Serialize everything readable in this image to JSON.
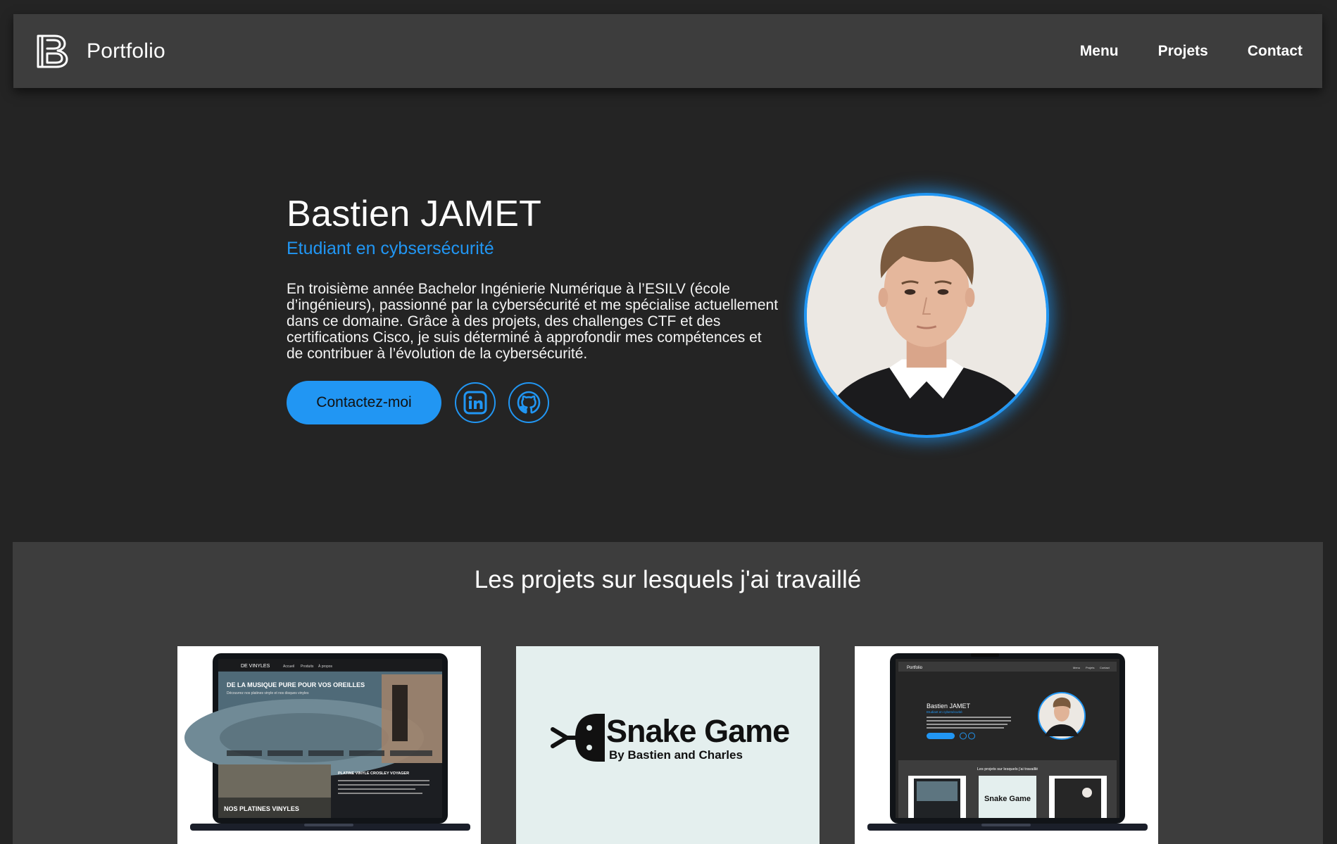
{
  "nav": {
    "logo_icon": "b-monogram-logo",
    "brand": "Portfolio",
    "links": [
      "Menu",
      "Projets",
      "Contact"
    ]
  },
  "hero": {
    "name": "Bastien JAMET",
    "role": "Etudiant en cybsersécurité",
    "description": "En troisième année Bachelor Ingénierie Numérique à l’ESILV (école d’ingénieurs), passionné par la cybersécurité et me spécialise actuellement dans ce domaine. Grâce à des projets, des challenges CTF et des certifications Cisco, je suis déterminé à approfondir mes compétences et de contribuer à l’évolution de la cybersécurité.",
    "contact_button": "Contactez-moi",
    "social_icons": [
      "linkedin-icon",
      "github-icon"
    ],
    "accent_color": "#2196f3"
  },
  "projects": {
    "title": "Les projets sur lesquels j'ai travaillé",
    "cards": [
      {
        "name": "vinyles-website",
        "screen_brand": "DE VINYLES",
        "screen_nav": [
          "Accueil",
          "Produits",
          "À propos"
        ],
        "screen_headline": "DE LA MUSIQUE PURE POUR VOS OREILLES",
        "screen_subline": "Découvrez nos platines vinyle et nos disques vinyles",
        "screen_banner": "NOS PLATINES VINYLES",
        "screen_product": "PLATINE VINYLE CROSLEY VOYAGER"
      },
      {
        "name": "snake-game",
        "title": "Snake Game",
        "subtitle": "By Bastien and Charles"
      },
      {
        "name": "portfolio-website",
        "screen_brand": "Portfolio",
        "screen_nav": [
          "Menu",
          "Projets",
          "Contact"
        ],
        "screen_name": "Bastien JAMET",
        "screen_role": "Etudiant en cybersécurité",
        "screen_projects_title": "Les projets sur lesquels j'ai travaillé",
        "screen_snake": "Snake Game"
      }
    ]
  }
}
